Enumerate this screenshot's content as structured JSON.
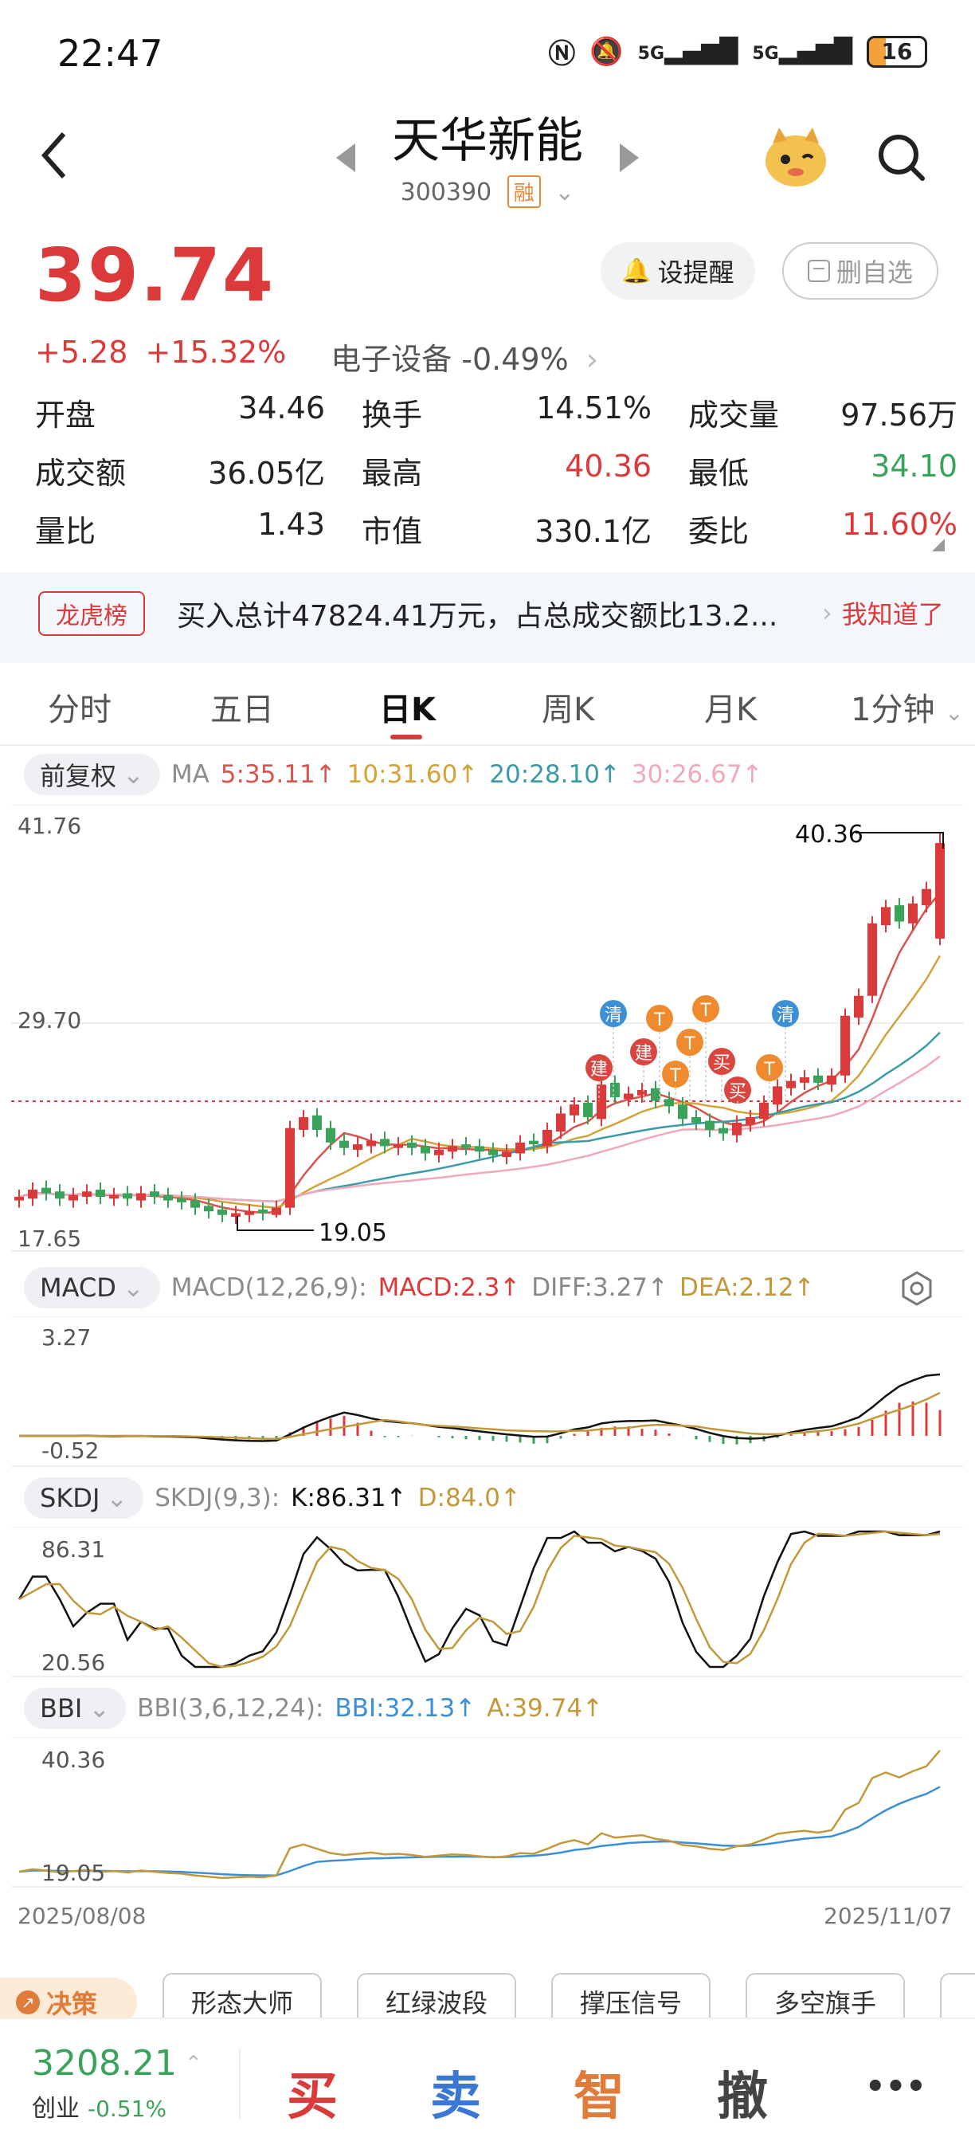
{
  "status": {
    "time": "22:47",
    "battery": "16",
    "net1": "5G",
    "net2": "5G"
  },
  "header": {
    "name": "天华新能",
    "code": "300390",
    "rong": "融"
  },
  "price": {
    "current": "39.74",
    "change": "+5.28",
    "change_pct": "+15.32%",
    "sector": "电子设备 -0.49%",
    "alert_btn": "设提醒",
    "remove_btn": "删自选"
  },
  "stats": [
    [
      {
        "label": "开盘",
        "value": "34.46",
        "color": "#222"
      },
      {
        "label": "换手",
        "value": "14.51%",
        "color": "#222"
      },
      {
        "label": "成交量",
        "value": "97.56万",
        "color": "#222"
      }
    ],
    [
      {
        "label": "成交额",
        "value": "36.05亿",
        "color": "#222"
      },
      {
        "label": "最高",
        "value": "40.36",
        "color": "#dc3a3a"
      },
      {
        "label": "最低",
        "value": "34.10",
        "color": "#3aa35a"
      }
    ],
    [
      {
        "label": "量比",
        "value": "1.43",
        "color": "#222"
      },
      {
        "label": "市值",
        "value": "330.1亿",
        "color": "#222"
      },
      {
        "label": "委比",
        "value": "11.60%",
        "color": "#dc3a3a"
      }
    ]
  ],
  "longhu": {
    "tag": "龙虎榜",
    "text": "买入总计47824.41万元，占总成交额比13.2...",
    "action": "我知道了"
  },
  "tabs": [
    "分时",
    "五日",
    "日K",
    "周K",
    "月K",
    "1分钟"
  ],
  "active_tab": "日K",
  "kline": {
    "adjust": "前复权",
    "ma_label": "MA",
    "ma": [
      {
        "text": "5:35.11↑",
        "color": "#d9534f"
      },
      {
        "text": "10:31.60↑",
        "color": "#d4a23a"
      },
      {
        "text": "20:28.10↑",
        "color": "#3a9aa8"
      },
      {
        "text": "30:26.67↑",
        "color": "#f0a9b8"
      }
    ],
    "y_top": "41.76",
    "y_mid": "29.70",
    "y_bot": "17.65",
    "high_label": "40.36",
    "low_label": "19.05",
    "signals": [
      {
        "t": "清",
        "c": "#3b8fd6"
      },
      {
        "t": "建",
        "c": "#d9463f"
      },
      {
        "t": "建",
        "c": "#d9463f"
      },
      {
        "t": "T",
        "c": "#ef8a2e"
      },
      {
        "t": "T",
        "c": "#ef8a2e"
      },
      {
        "t": "T",
        "c": "#ef8a2e"
      },
      {
        "t": "T",
        "c": "#ef8a2e"
      },
      {
        "t": "买",
        "c": "#d9463f"
      },
      {
        "t": "买",
        "c": "#d9463f"
      },
      {
        "t": "T",
        "c": "#ef8a2e"
      },
      {
        "t": "清",
        "c": "#3b8fd6"
      }
    ]
  },
  "macd": {
    "name": "MACD",
    "params": "MACD(12,26,9):",
    "macd": "MACD:2.3↑",
    "diff": "DIFF:3.27↑",
    "dea": "DEA:2.12↑",
    "y_top": "3.27",
    "y_bot": "-0.52"
  },
  "skdj": {
    "name": "SKDJ",
    "params": "SKDJ(9,3):",
    "k": "K:86.31↑",
    "d": "D:84.0↑",
    "y_top": "86.31",
    "y_bot": "20.56"
  },
  "bbi": {
    "name": "BBI",
    "params": "BBI(3,6,12,24):",
    "bbi": "BBI:32.13↑",
    "a": "A:39.74↑",
    "y_top": "40.36",
    "y_bot": "19.05"
  },
  "dates": {
    "start": "2025/08/08",
    "end": "2025/11/07"
  },
  "tools": {
    "badge": "决策",
    "items": [
      "形态大师",
      "红绿波段",
      "撑压信号",
      "多空旗手"
    ]
  },
  "bottom": {
    "index_value": "3208.21",
    "index_name": "创业",
    "index_change": "-0.51%",
    "buy": "买",
    "sell": "卖",
    "smart": "智",
    "cancel": "撤",
    "more": "•••"
  },
  "colors": {
    "up": "#dc3a3a",
    "down": "#3aa35a",
    "accent": "#e07b39"
  }
}
